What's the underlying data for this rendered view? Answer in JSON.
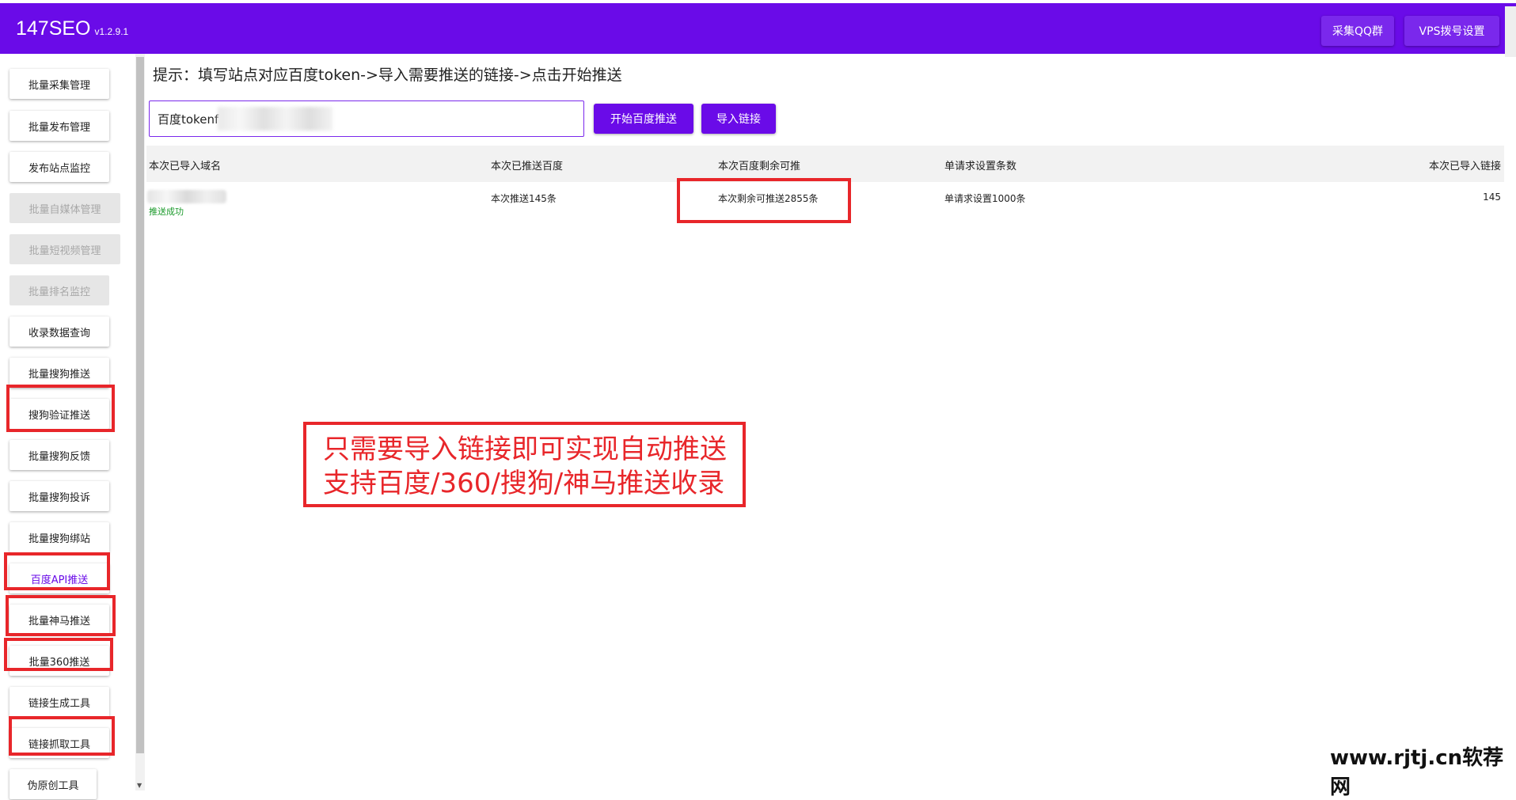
{
  "header": {
    "brand": "147SEO",
    "version": "v1.2.9.1",
    "buttons": {
      "qq_group": "采集QQ群",
      "vps_settings": "VPS拨号设置"
    }
  },
  "sidebar": {
    "items": [
      {
        "label": "批量采集管理",
        "state": "normal"
      },
      {
        "label": "批量发布管理",
        "state": "normal"
      },
      {
        "label": "发布站点监控",
        "state": "normal"
      },
      {
        "label": "批量自媒体管理",
        "state": "disabled"
      },
      {
        "label": "批量短视频管理",
        "state": "disabled"
      },
      {
        "label": "批量排名监控",
        "state": "disabled"
      },
      {
        "label": "收录数据查询",
        "state": "normal"
      },
      {
        "label": "批量搜狗推送",
        "state": "normal"
      },
      {
        "label": "搜狗验证推送",
        "state": "normal"
      },
      {
        "label": "批量搜狗反馈",
        "state": "normal"
      },
      {
        "label": "批量搜狗投诉",
        "state": "normal"
      },
      {
        "label": "批量搜狗绑站",
        "state": "normal"
      },
      {
        "label": "百度API推送",
        "state": "active"
      },
      {
        "label": "批量神马推送",
        "state": "normal"
      },
      {
        "label": "批量360推送",
        "state": "normal"
      },
      {
        "label": "链接生成工具",
        "state": "normal"
      },
      {
        "label": "链接抓取工具",
        "state": "normal"
      },
      {
        "label": "伪原创工具",
        "state": "normal"
      }
    ]
  },
  "main": {
    "hint": "提示：填写站点对应百度token->导入需要推送的链接->点击开始推送",
    "token_input": {
      "value": "百度tokenf"
    },
    "buttons": {
      "start_push": "开始百度推送",
      "import_links": "导入链接"
    },
    "table": {
      "headers": [
        "本次已导入域名",
        "本次已推送百度",
        "本次百度剩余可推",
        "单请求设置条数",
        "本次已导入链接"
      ],
      "rows": [
        {
          "status": "推送成功",
          "pushed": "本次推送145条",
          "remaining": "本次剩余可推送2855条",
          "per_request": "单请求设置1000条",
          "imported": "145"
        }
      ]
    }
  },
  "annotation": {
    "line1": "只需要导入链接即可实现自动推送",
    "line2": "支持百度/360/搜狗/神马推送收录"
  },
  "watermark": "www.rjtj.cn软荐网",
  "colors": {
    "brand_purple": "#6a0be8",
    "highlight_red": "#e8262a",
    "success_green": "#1b9a2b"
  }
}
